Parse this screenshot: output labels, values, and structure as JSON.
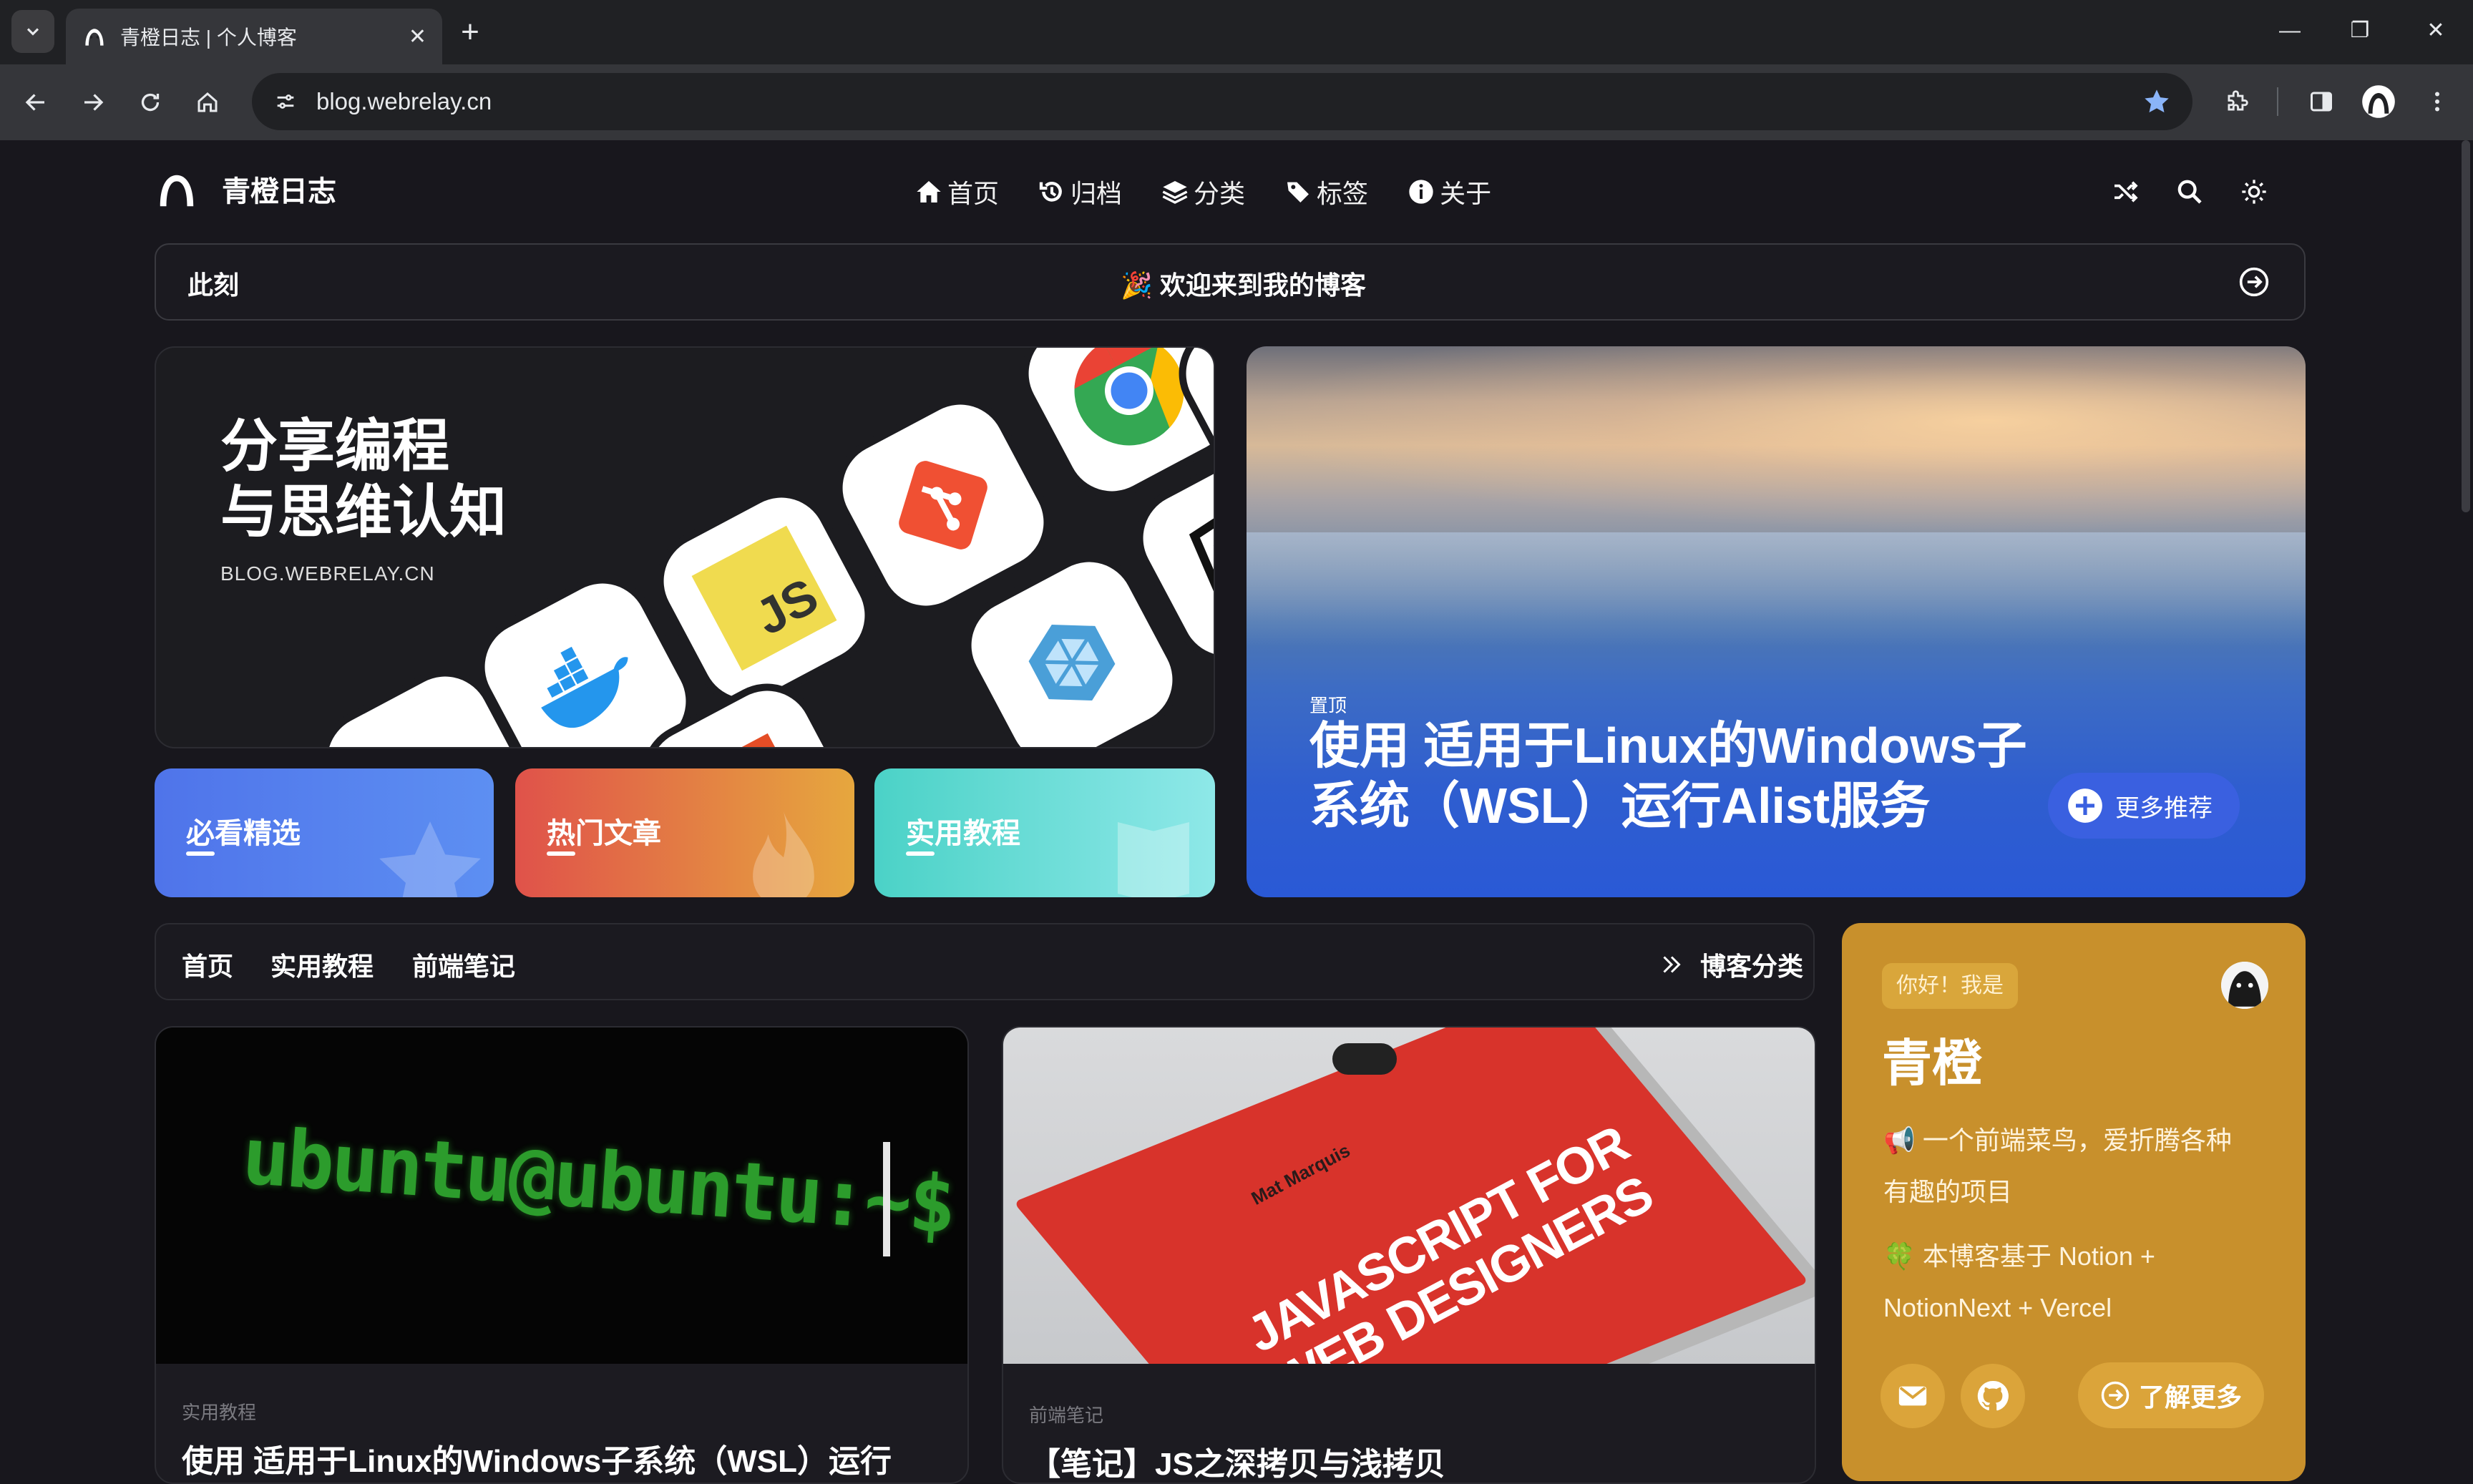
{
  "browser": {
    "tab_title": "青橙日志 | 个人博客",
    "url": "blog.webrelay.cn"
  },
  "header": {
    "site_name": "青橙日志",
    "menu": [
      {
        "label": "首页",
        "icon": "home-icon"
      },
      {
        "label": "归档",
        "icon": "history-icon"
      },
      {
        "label": "分类",
        "icon": "layers-icon"
      },
      {
        "label": "标签",
        "icon": "tag-icon"
      },
      {
        "label": "关于",
        "icon": "info-icon"
      }
    ]
  },
  "notice": {
    "label": "此刻",
    "text": "🎉 欢迎来到我的博客"
  },
  "hero": {
    "title_line1": "分享编程",
    "title_line2": "与思维认知",
    "subtitle": "BLOG.WEBRELAY.CN",
    "categories": [
      {
        "label": "必看精选",
        "color_from": "#4f74ea",
        "color_to": "#5d8ff2"
      },
      {
        "label": "热门文章",
        "color_from": "#e0524a",
        "color_to": "#e6a73e"
      },
      {
        "label": "实用教程",
        "color_from": "#4bd2c7",
        "color_to": "#8ee8e8"
      }
    ],
    "featured_tag": "置顶",
    "featured_title": "使用 适用于Linux的Windows子系统（WSL）运行Alist服务",
    "more_label": "更多推荐"
  },
  "catnav": {
    "items": [
      "首页",
      "实用教程",
      "前端笔记"
    ],
    "more_label": "博客分类"
  },
  "posts": [
    {
      "category": "实用教程",
      "title": "使用 适用于Linux的Windows子系统（WSL）运行",
      "image_text": "ubuntu@ubuntu:~$"
    },
    {
      "category": "前端笔记",
      "title": "【笔记】JS之深拷贝与浅拷贝",
      "image_text": "JAVASCRIPT FOR WEB DESIGNERS",
      "image_author": "Mat Marquis"
    }
  ],
  "profile": {
    "greeting": "你好！我是",
    "name": "青橙",
    "line1": "📢 一个前端菜鸟，爱折腾各种",
    "line2": "有趣的项目",
    "line3": "🍀 本博客基于 Notion +",
    "line4": "NotionNext + Vercel",
    "learn_more": "了解更多",
    "accent": "#c8902c"
  }
}
